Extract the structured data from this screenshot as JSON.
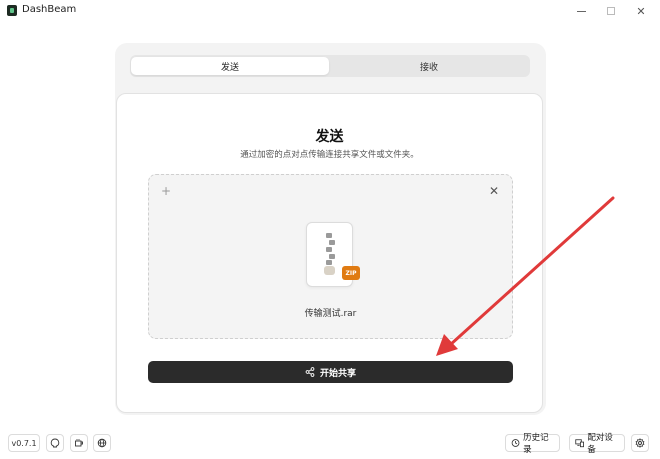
{
  "window": {
    "title": "DashBeam"
  },
  "tabs": [
    {
      "label": "发送",
      "selected": true
    },
    {
      "label": "接收",
      "selected": false
    }
  ],
  "send": {
    "title": "发送",
    "subtitle": "通过加密的点对点传输连接共享文件或文件夹。",
    "file": {
      "name": "传输测试.rar",
      "badge": "ZIP",
      "icon": "zip-file-icon"
    },
    "share_button_label": "开始共享"
  },
  "footer": {
    "version": "v0.7.1",
    "history_label": "历史记录",
    "pair_label": "配对设备"
  },
  "colors": {
    "accent_dark": "#2b2b2b",
    "badge_orange": "#e07b12",
    "annotation_red": "#e03a3a"
  }
}
